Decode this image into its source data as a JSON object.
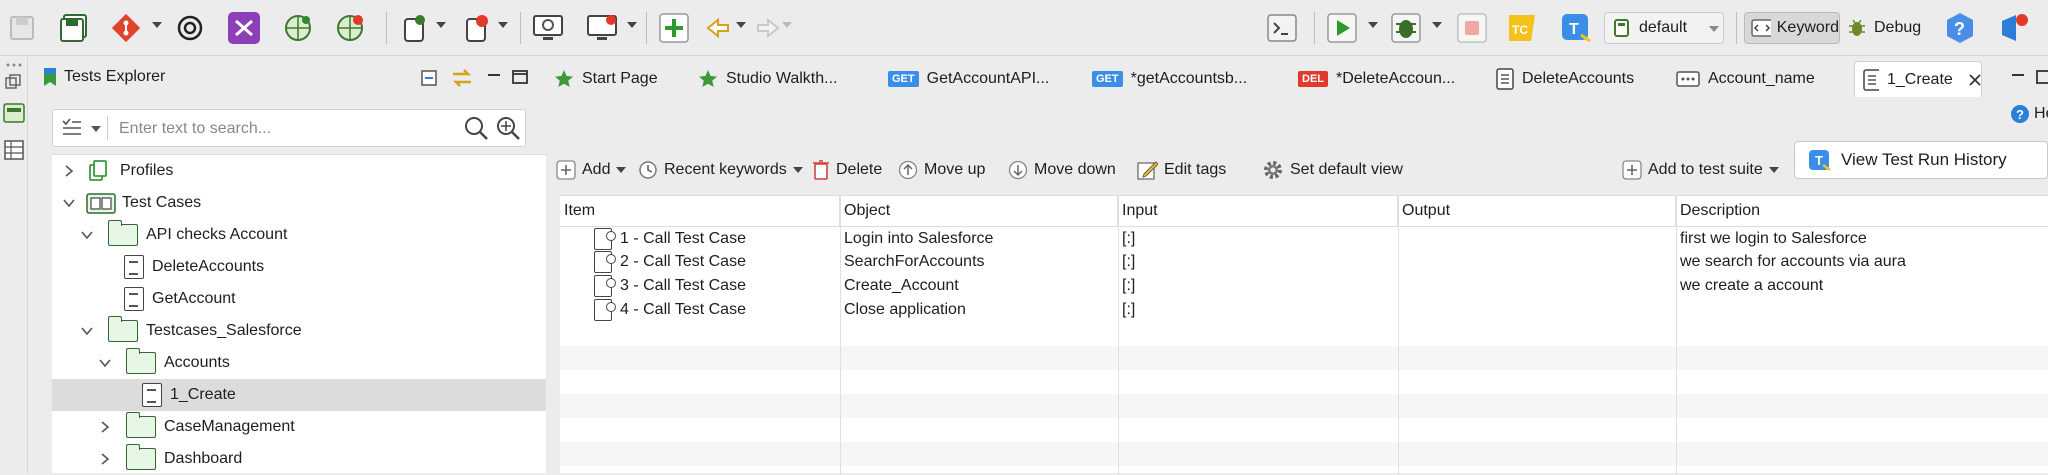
{
  "toolbar": {
    "profile_value": "default",
    "keyword_label": "Keyword",
    "debug_label": "Debug"
  },
  "explorer": {
    "title": "Tests Explorer",
    "search_placeholder": "Enter text to search...",
    "tree": [
      {
        "label": "Profiles",
        "type": "profiles",
        "level": 0,
        "expanded": false
      },
      {
        "label": "Test Cases",
        "type": "testcases",
        "level": 0,
        "expanded": true
      },
      {
        "label": "API checks Account",
        "type": "folder",
        "level": 1,
        "expanded": true
      },
      {
        "label": "DeleteAccounts",
        "type": "doc",
        "level": 2
      },
      {
        "label": "GetAccount",
        "type": "doc",
        "level": 2
      },
      {
        "label": "Testcases_Salesforce",
        "type": "folder",
        "level": 1,
        "expanded": true
      },
      {
        "label": "Accounts",
        "type": "folder",
        "level": 2,
        "expanded": true
      },
      {
        "label": "1_Create",
        "type": "doc",
        "level": 3,
        "selected": true
      },
      {
        "label": "CaseManagement",
        "type": "folder",
        "level": 2,
        "expanded": false
      },
      {
        "label": "Dashboard",
        "type": "folder",
        "level": 2,
        "expanded": false
      }
    ]
  },
  "editor": {
    "tabs": [
      {
        "label": "Start Page",
        "icon": "star-icon"
      },
      {
        "label": "Studio Walkth...",
        "icon": "star-icon"
      },
      {
        "label": "GetAccountAPI...",
        "badge": "GET"
      },
      {
        "label": "*getAccountsb...",
        "badge": "GET"
      },
      {
        "label": "*DeleteAccoun...",
        "badge": "DEL"
      },
      {
        "label": "DeleteAccounts",
        "icon": "test-case-icon"
      },
      {
        "label": "Account_name",
        "icon": "variable-icon"
      },
      {
        "label": "1_Create",
        "icon": "test-case-icon",
        "active": true
      }
    ],
    "help_label": "Hel",
    "actions": {
      "add": "Add",
      "recent": "Recent keywords",
      "delete": "Delete",
      "move_up": "Move up",
      "move_down": "Move down",
      "edit_tags": "Edit tags",
      "set_default": "Set default view",
      "add_suite": "Add to test suite",
      "view_history": "View Test Run History"
    },
    "columns": [
      "Item",
      "Object",
      "Input",
      "Output",
      "Description"
    ],
    "rows": [
      {
        "item": "1 - Call Test Case",
        "object": "Login into Salesforce",
        "input": "[:]",
        "output": "",
        "description": "first we login to Salesforce"
      },
      {
        "item": "2 - Call Test Case",
        "object": "SearchForAccounts",
        "input": "[:]",
        "output": "",
        "description": "we search for accounts via aura"
      },
      {
        "item": "3 - Call Test Case",
        "object": "Create_Account",
        "input": "[:]",
        "output": "",
        "description": "we create a account"
      },
      {
        "item": "4 - Call Test Case",
        "object": "Close application",
        "input": "[:]",
        "output": "",
        "description": ""
      }
    ]
  }
}
